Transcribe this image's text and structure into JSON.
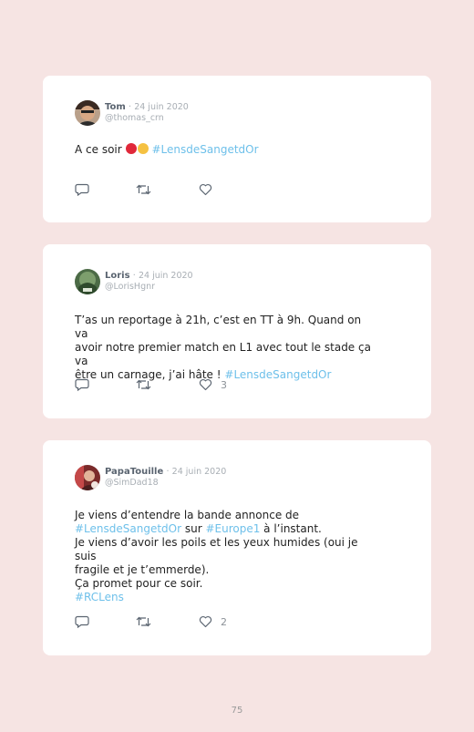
{
  "tweets": [
    {
      "name": "Tom",
      "sep": "·",
      "date": "24 juin 2020",
      "handle": "@thomas_crn",
      "text_before": "A ce soir ",
      "emoji_colors": [
        "#e0283a",
        "#f5c142"
      ],
      "hashtag": "#LensdeSangetdOr",
      "likes": ""
    },
    {
      "name": "Loris",
      "sep": "·",
      "date": "24 juin 2020",
      "handle": "@LorisHgnr",
      "lines": [
        "T’as un reportage à 21h, c’est en TT à 9h. Quand on va",
        "avoir notre premier match en L1 avec tout le stade ça va"
      ],
      "line3_text": "être un carnage, j’ai hâte ! ",
      "line3_tag": "#LensdeSangetdOr",
      "likes": "3"
    },
    {
      "name": "PapaTouille",
      "sep": "·",
      "date": "24 juin 2020",
      "handle": "@SimDad18",
      "l1": "Je viens d’entendre la bande annonce de",
      "l2_tag1": "#LensdeSangetdOr",
      "l2_mid": " sur ",
      "l2_tag2": "#Europe1",
      "l2_end": " à l’instant.",
      "l3": "Je viens d’avoir les poils et les yeux humides (oui je suis",
      "l4": "fragile et je t’emmerde).",
      "l5": "Ça promet pour ce soir.",
      "l6_tag": "#RCLens",
      "likes": "2"
    }
  ],
  "page_number": "75"
}
